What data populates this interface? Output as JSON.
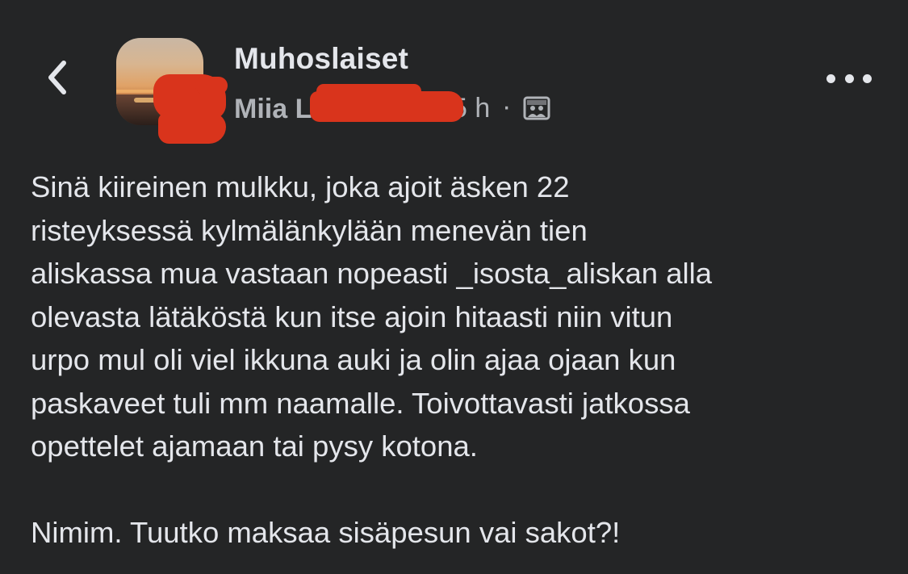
{
  "header": {
    "group_name": "Muhoslaiset",
    "author_name": "Miia L",
    "post_time": "5 h",
    "separator": "·",
    "audience_icon": "group-photo-icon",
    "back_icon": "chevron-left-icon",
    "more_icon": "more-options-icon"
  },
  "post": {
    "body": "Sinä kiireinen mulkku, joka ajoit äsken 22\nristeyksessä kylmälänkylään menevän tien\naliskassa mua vastaan nopeasti _isosta_aliskan alla\nolevasta lätäköstä kun itse ajoin hitaasti niin vitun\nurpo mul oli viel ikkuna auki ja olin ajaa ojaan kun\npaskaveet tuli mm naamalle. Toivottavasti jatkossa\nopettelet ajamaan tai pysy kotona.\n\nNimim. Tuutko maksaa sisäpesun vai sakot?!"
  },
  "colors": {
    "background": "#242526",
    "primary_text": "#e4e6eb",
    "secondary_text": "#b0b3b8",
    "redaction": "#d9341c"
  }
}
